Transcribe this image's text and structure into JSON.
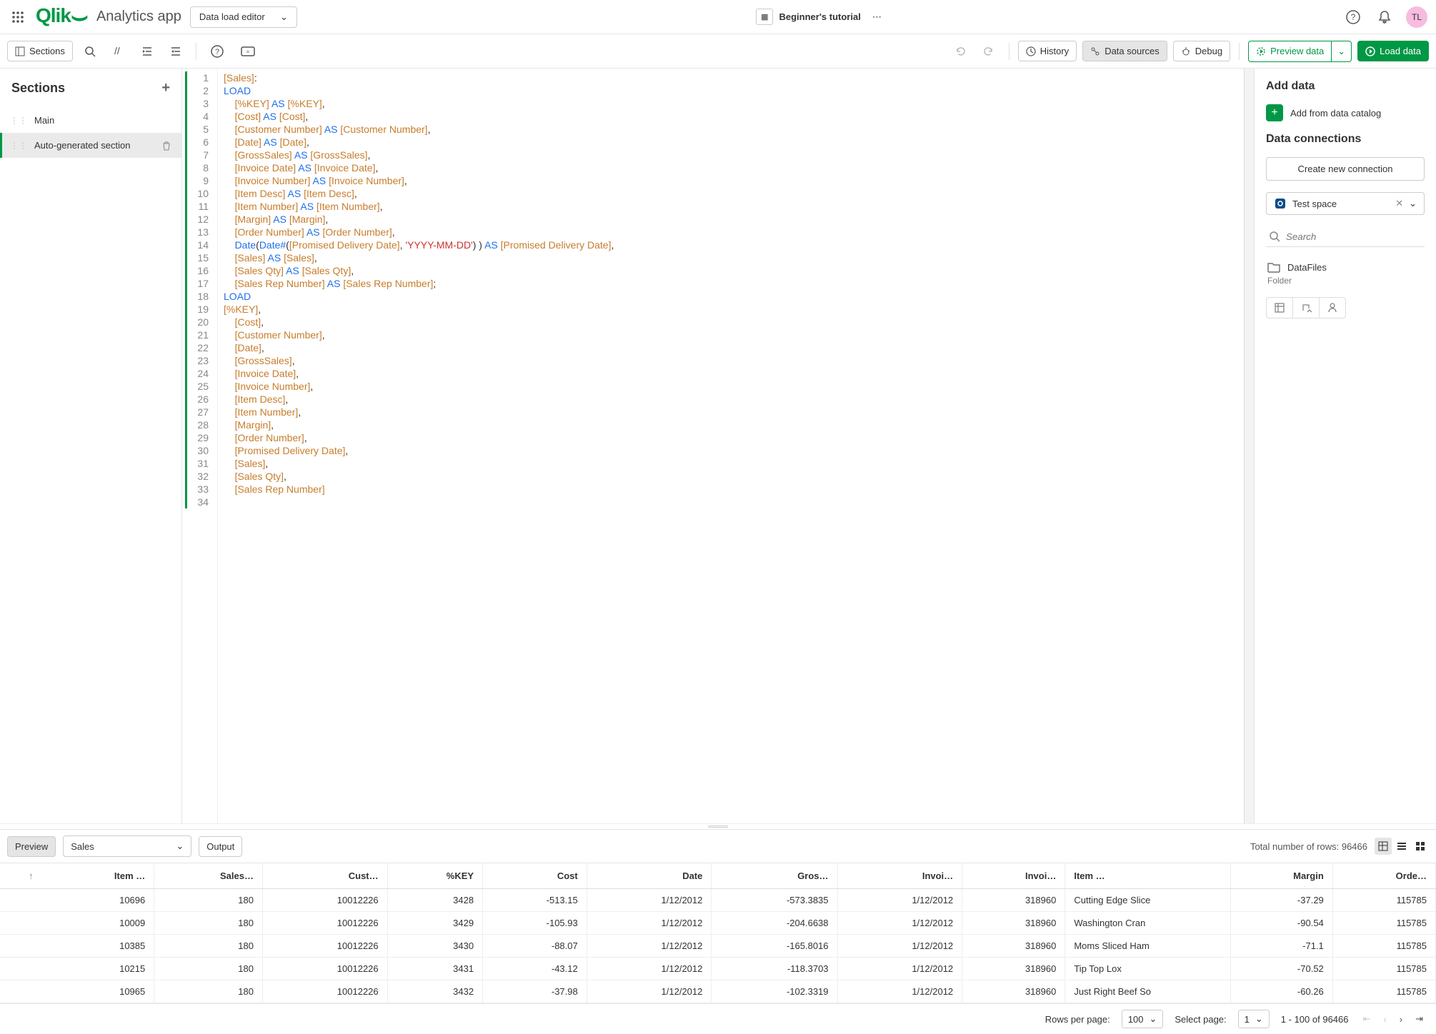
{
  "header": {
    "app_name": "Analytics app",
    "view_select": "Data load editor",
    "doc_title": "Beginner's tutorial",
    "avatar": "TL"
  },
  "toolbar": {
    "sections": "Sections",
    "history": "History",
    "data_sources": "Data sources",
    "debug": "Debug",
    "preview_data": "Preview data",
    "load_data": "Load data"
  },
  "sidebar": {
    "title": "Sections",
    "items": [
      {
        "label": "Main",
        "active": false
      },
      {
        "label": "Auto-generated section",
        "active": true
      }
    ]
  },
  "code_lines": [
    {
      "n": 1,
      "tokens": [
        [
          "br",
          "[Sales]"
        ],
        [
          "",
          ":"
        ]
      ]
    },
    {
      "n": 2,
      "tokens": [
        [
          "kw",
          "LOAD"
        ]
      ]
    },
    {
      "n": 3,
      "tokens": [
        [
          "",
          "    "
        ],
        [
          "br",
          "[%KEY]"
        ],
        [
          "",
          " "
        ],
        [
          "kw",
          "AS"
        ],
        [
          "",
          " "
        ],
        [
          "br",
          "[%KEY]"
        ],
        [
          "",
          ","
        ]
      ]
    },
    {
      "n": 4,
      "tokens": [
        [
          "",
          "    "
        ],
        [
          "br",
          "[Cost]"
        ],
        [
          "",
          " "
        ],
        [
          "kw",
          "AS"
        ],
        [
          "",
          " "
        ],
        [
          "br",
          "[Cost]"
        ],
        [
          "",
          ","
        ]
      ]
    },
    {
      "n": 5,
      "tokens": [
        [
          "",
          "    "
        ],
        [
          "br",
          "[Customer Number]"
        ],
        [
          "",
          " "
        ],
        [
          "kw",
          "AS"
        ],
        [
          "",
          " "
        ],
        [
          "br",
          "[Customer Number]"
        ],
        [
          "",
          ","
        ]
      ]
    },
    {
      "n": 6,
      "tokens": [
        [
          "",
          "    "
        ],
        [
          "br",
          "[Date]"
        ],
        [
          "",
          " "
        ],
        [
          "kw",
          "AS"
        ],
        [
          "",
          " "
        ],
        [
          "br",
          "[Date]"
        ],
        [
          "",
          ","
        ]
      ]
    },
    {
      "n": 7,
      "tokens": [
        [
          "",
          "    "
        ],
        [
          "br",
          "[GrossSales]"
        ],
        [
          "",
          " "
        ],
        [
          "kw",
          "AS"
        ],
        [
          "",
          " "
        ],
        [
          "br",
          "[GrossSales]"
        ],
        [
          "",
          ","
        ]
      ]
    },
    {
      "n": 8,
      "tokens": [
        [
          "",
          "    "
        ],
        [
          "br",
          "[Invoice Date]"
        ],
        [
          "",
          " "
        ],
        [
          "kw",
          "AS"
        ],
        [
          "",
          " "
        ],
        [
          "br",
          "[Invoice Date]"
        ],
        [
          "",
          ","
        ]
      ]
    },
    {
      "n": 9,
      "tokens": [
        [
          "",
          "    "
        ],
        [
          "br",
          "[Invoice Number]"
        ],
        [
          "",
          " "
        ],
        [
          "kw",
          "AS"
        ],
        [
          "",
          " "
        ],
        [
          "br",
          "[Invoice Number]"
        ],
        [
          "",
          ","
        ]
      ]
    },
    {
      "n": 10,
      "tokens": [
        [
          "",
          "    "
        ],
        [
          "br",
          "[Item Desc]"
        ],
        [
          "",
          " "
        ],
        [
          "kw",
          "AS"
        ],
        [
          "",
          " "
        ],
        [
          "br",
          "[Item Desc]"
        ],
        [
          "",
          ","
        ]
      ]
    },
    {
      "n": 11,
      "tokens": [
        [
          "",
          "    "
        ],
        [
          "br",
          "[Item Number]"
        ],
        [
          "",
          " "
        ],
        [
          "kw",
          "AS"
        ],
        [
          "",
          " "
        ],
        [
          "br",
          "[Item Number]"
        ],
        [
          "",
          ","
        ]
      ]
    },
    {
      "n": 12,
      "tokens": [
        [
          "",
          "    "
        ],
        [
          "br",
          "[Margin]"
        ],
        [
          "",
          " "
        ],
        [
          "kw",
          "AS"
        ],
        [
          "",
          " "
        ],
        [
          "br",
          "[Margin]"
        ],
        [
          "",
          ","
        ]
      ]
    },
    {
      "n": 13,
      "tokens": [
        [
          "",
          "    "
        ],
        [
          "br",
          "[Order Number]"
        ],
        [
          "",
          " "
        ],
        [
          "kw",
          "AS"
        ],
        [
          "",
          " "
        ],
        [
          "br",
          "[Order Number]"
        ],
        [
          "",
          ","
        ]
      ]
    },
    {
      "n": 14,
      "tokens": [
        [
          "",
          "    "
        ],
        [
          "fn",
          "Date"
        ],
        [
          "",
          "("
        ],
        [
          "fn",
          "Date#"
        ],
        [
          "",
          "("
        ],
        [
          "br",
          "[Promised Delivery Date]"
        ],
        [
          "",
          ", "
        ],
        [
          "str",
          "'YYYY-MM-DD'"
        ],
        [
          "",
          ") ) "
        ],
        [
          "kw",
          "AS"
        ],
        [
          "",
          " "
        ],
        [
          "br",
          "[Promised Delivery Date]"
        ],
        [
          "",
          ","
        ]
      ]
    },
    {
      "n": 15,
      "tokens": [
        [
          "",
          "    "
        ],
        [
          "br",
          "[Sales]"
        ],
        [
          "",
          " "
        ],
        [
          "kw",
          "AS"
        ],
        [
          "",
          " "
        ],
        [
          "br",
          "[Sales]"
        ],
        [
          "",
          ","
        ]
      ]
    },
    {
      "n": 16,
      "tokens": [
        [
          "",
          "    "
        ],
        [
          "br",
          "[Sales Qty]"
        ],
        [
          "",
          " "
        ],
        [
          "kw",
          "AS"
        ],
        [
          "",
          " "
        ],
        [
          "br",
          "[Sales Qty]"
        ],
        [
          "",
          ","
        ]
      ]
    },
    {
      "n": 17,
      "tokens": [
        [
          "",
          "    "
        ],
        [
          "br",
          "[Sales Rep Number]"
        ],
        [
          "",
          " "
        ],
        [
          "kw",
          "AS"
        ],
        [
          "",
          " "
        ],
        [
          "br",
          "[Sales Rep Number]"
        ],
        [
          "",
          ";"
        ]
      ]
    },
    {
      "n": 18,
      "tokens": [
        [
          "kw",
          "LOAD"
        ]
      ]
    },
    {
      "n": 19,
      "tokens": [
        [
          "br",
          "[%KEY]"
        ],
        [
          "",
          ","
        ]
      ]
    },
    {
      "n": 20,
      "tokens": [
        [
          "",
          "    "
        ],
        [
          "br",
          "[Cost]"
        ],
        [
          "",
          ","
        ]
      ]
    },
    {
      "n": 21,
      "tokens": [
        [
          "",
          "    "
        ],
        [
          "br",
          "[Customer Number]"
        ],
        [
          "",
          ","
        ]
      ]
    },
    {
      "n": 22,
      "tokens": [
        [
          "",
          "    "
        ],
        [
          "br",
          "[Date]"
        ],
        [
          "",
          ","
        ]
      ]
    },
    {
      "n": 23,
      "tokens": [
        [
          "",
          "    "
        ],
        [
          "br",
          "[GrossSales]"
        ],
        [
          "",
          ","
        ]
      ]
    },
    {
      "n": 24,
      "tokens": [
        [
          "",
          "    "
        ],
        [
          "br",
          "[Invoice Date]"
        ],
        [
          "",
          ","
        ]
      ]
    },
    {
      "n": 25,
      "tokens": [
        [
          "",
          "    "
        ],
        [
          "br",
          "[Invoice Number]"
        ],
        [
          "",
          ","
        ]
      ]
    },
    {
      "n": 26,
      "tokens": [
        [
          "",
          "    "
        ],
        [
          "br",
          "[Item Desc]"
        ],
        [
          "",
          ","
        ]
      ]
    },
    {
      "n": 27,
      "tokens": [
        [
          "",
          "    "
        ],
        [
          "br",
          "[Item Number]"
        ],
        [
          "",
          ","
        ]
      ]
    },
    {
      "n": 28,
      "tokens": [
        [
          "",
          "    "
        ],
        [
          "br",
          "[Margin]"
        ],
        [
          "",
          ","
        ]
      ]
    },
    {
      "n": 29,
      "tokens": [
        [
          "",
          "    "
        ],
        [
          "br",
          "[Order Number]"
        ],
        [
          "",
          ","
        ]
      ]
    },
    {
      "n": 30,
      "tokens": [
        [
          "",
          "    "
        ],
        [
          "br",
          "[Promised Delivery Date]"
        ],
        [
          "",
          ","
        ]
      ]
    },
    {
      "n": 31,
      "tokens": [
        [
          "",
          "    "
        ],
        [
          "br",
          "[Sales]"
        ],
        [
          "",
          ","
        ]
      ]
    },
    {
      "n": 32,
      "tokens": [
        [
          "",
          "    "
        ],
        [
          "br",
          "[Sales Qty]"
        ],
        [
          "",
          ","
        ]
      ]
    },
    {
      "n": 33,
      "tokens": [
        [
          "",
          "    "
        ],
        [
          "br",
          "[Sales Rep Number]"
        ]
      ]
    },
    {
      "n": 34,
      "tokens": [
        [
          "",
          ""
        ]
      ]
    }
  ],
  "right_panel": {
    "add_data": "Add data",
    "add_catalog": "Add from data catalog",
    "data_connections": "Data connections",
    "create_new": "Create new connection",
    "space": "Test space",
    "search_placeholder": "Search",
    "file_name": "DataFiles",
    "folder_label": "Folder"
  },
  "preview": {
    "preview_btn": "Preview",
    "table_select": "Sales",
    "output_btn": "Output",
    "total_rows_label": "Total number of rows: 96466",
    "columns": [
      "Item …",
      "Sales…",
      "Cust…",
      "%KEY",
      "Cost",
      "Date",
      "Gros…",
      "Invoi…",
      "Invoi…",
      "Item …",
      "Margin",
      "Orde…"
    ],
    "rows": [
      [
        "10696",
        "180",
        "10012226",
        "3428",
        "-513.15",
        "1/12/2012",
        "-573.3835",
        "1/12/2012",
        "318960",
        "Cutting Edge Slice",
        "-37.29",
        "115785"
      ],
      [
        "10009",
        "180",
        "10012226",
        "3429",
        "-105.93",
        "1/12/2012",
        "-204.6638",
        "1/12/2012",
        "318960",
        "Washington Cran",
        "-90.54",
        "115785"
      ],
      [
        "10385",
        "180",
        "10012226",
        "3430",
        "-88.07",
        "1/12/2012",
        "-165.8016",
        "1/12/2012",
        "318960",
        "Moms Sliced Ham",
        "-71.1",
        "115785"
      ],
      [
        "10215",
        "180",
        "10012226",
        "3431",
        "-43.12",
        "1/12/2012",
        "-118.3703",
        "1/12/2012",
        "318960",
        "Tip Top Lox",
        "-70.52",
        "115785"
      ],
      [
        "10965",
        "180",
        "10012226",
        "3432",
        "-37.98",
        "1/12/2012",
        "-102.3319",
        "1/12/2012",
        "318960",
        "Just Right Beef So",
        "-60.26",
        "115785"
      ]
    ]
  },
  "footer": {
    "rows_per_page_label": "Rows per page:",
    "rows_per_page": "100",
    "select_page_label": "Select page:",
    "select_page": "1",
    "range": "1 - 100 of 96466"
  }
}
